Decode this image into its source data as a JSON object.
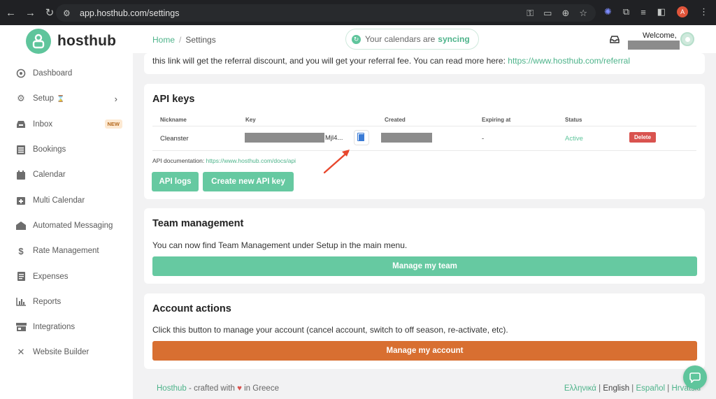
{
  "browser": {
    "url": "app.hosthub.com/settings",
    "profile_initial": "A"
  },
  "brand": {
    "name": "hosthub",
    "accent": "#5fc59c",
    "danger": "#d9534f",
    "orange": "#d86f31"
  },
  "sidebar": {
    "items": [
      {
        "label": "Dashboard",
        "icon": "dashboard-icon"
      },
      {
        "label": "Setup",
        "icon": "gears-icon"
      },
      {
        "label": "Inbox",
        "icon": "inbox-icon",
        "badge": "NEW"
      },
      {
        "label": "Bookings",
        "icon": "list-icon"
      },
      {
        "label": "Calendar",
        "icon": "calendar-icon"
      },
      {
        "label": "Multi Calendar",
        "icon": "calendar-plus-icon"
      },
      {
        "label": "Automated Messaging",
        "icon": "envelope-open-icon"
      },
      {
        "label": "Rate Management",
        "icon": "dollar-icon"
      },
      {
        "label": "Expenses",
        "icon": "receipt-icon"
      },
      {
        "label": "Reports",
        "icon": "bar-chart-icon"
      },
      {
        "label": "Integrations",
        "icon": "store-icon"
      },
      {
        "label": "Website Builder",
        "icon": "tools-icon"
      }
    ]
  },
  "header": {
    "breadcrumb_home": "Home",
    "breadcrumb_sep": "/",
    "breadcrumb_current": "Settings",
    "sync_prefix": "Your calendars are",
    "sync_status": "syncing",
    "welcome": "Welcome,"
  },
  "referral": {
    "text": "this link will get the referral discount, and you will get your referral fee. You can read more here:",
    "link": "https://www.hosthub.com/referral"
  },
  "api_keys": {
    "title": "API keys",
    "columns": [
      "Nickname",
      "Key",
      "Created",
      "Expiring at",
      "Status"
    ],
    "rows": [
      {
        "nickname": "Cleanster",
        "key_tail": "Mjl4...",
        "expiring": "-",
        "status": "Active",
        "action": "Delete"
      }
    ],
    "doc_label": "API documentation:",
    "doc_link": "https://www.hosthub.com/docs/api",
    "btn_logs": "API logs",
    "btn_create": "Create new API key"
  },
  "team": {
    "title": "Team management",
    "text": "You can now find Team Management under Setup in the main menu.",
    "button": "Manage my team"
  },
  "account": {
    "title": "Account actions",
    "text": "Click this button to manage your account (cancel account, switch to off season, re-activate, etc).",
    "button": "Manage my account"
  },
  "footer": {
    "brand": "Hosthub",
    "crafted": "- crafted with",
    "heart": "♥",
    "in": "in Greece",
    "languages": [
      "Ελληνικά",
      "English",
      "Español",
      "Hrvatski"
    ],
    "sep": "|"
  }
}
